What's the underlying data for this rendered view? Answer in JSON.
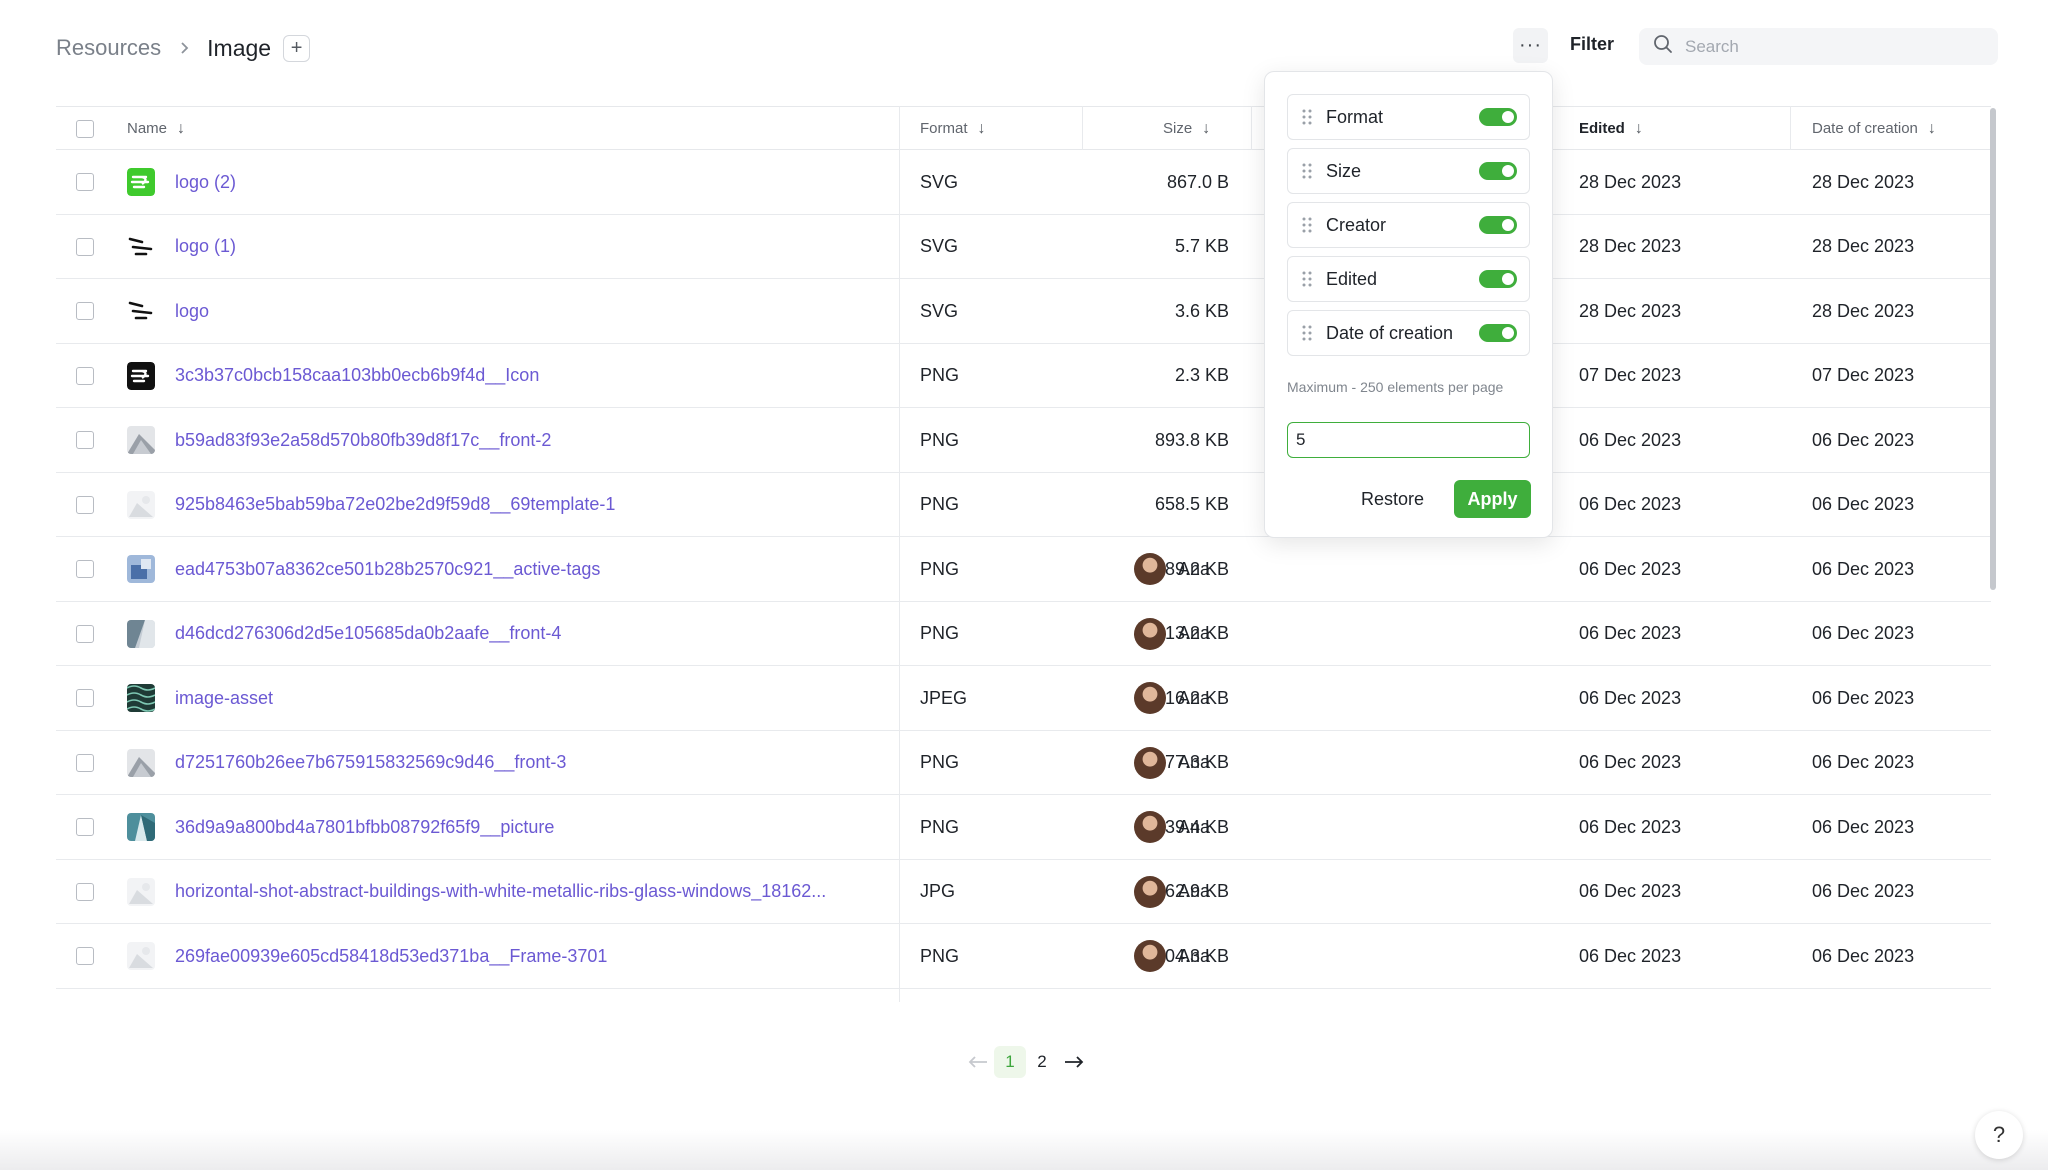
{
  "breadcrumb": {
    "root": "Resources",
    "current": "Image",
    "add_label": "+"
  },
  "toolbar": {
    "more_label": "···",
    "filter_label": "Filter",
    "search_placeholder": "Search"
  },
  "table": {
    "columns": {
      "name": "Name",
      "format": "Format",
      "size": "Size",
      "edited": "Edited",
      "created": "Date of creation"
    },
    "sort_arrow": "↓",
    "rows": [
      {
        "name": "logo (2)",
        "format": "SVG",
        "size": "867.0 B",
        "creator": "",
        "edited": "28 Dec 2023",
        "created": "28 Dec 2023",
        "thumb": "green-logo-icon"
      },
      {
        "name": "logo (1)",
        "format": "SVG",
        "size": "5.7 KB",
        "creator": "",
        "edited": "28 Dec 2023",
        "created": "28 Dec 2023",
        "thumb": "stripes-logo-icon"
      },
      {
        "name": "logo",
        "format": "SVG",
        "size": "3.6 KB",
        "creator": "",
        "edited": "28 Dec 2023",
        "created": "28 Dec 2023",
        "thumb": "stripes-logo-icon"
      },
      {
        "name": "3c3b37c0bcb158caa103bb0ecb6b9f4d__Icon",
        "format": "PNG",
        "size": "2.3 KB",
        "creator": "",
        "edited": "07 Dec 2023",
        "created": "07 Dec 2023",
        "thumb": "black-logo-icon"
      },
      {
        "name": "b59ad83f93e2a58d570b80fb39d8f17c__front-2",
        "format": "PNG",
        "size": "893.8 KB",
        "creator": "",
        "edited": "06 Dec 2023",
        "created": "06 Dec 2023",
        "thumb": "gray-photo"
      },
      {
        "name": "925b8463e5bab59ba72e02be2d9f59d8__69template-1",
        "format": "PNG",
        "size": "658.5 KB",
        "creator": "",
        "edited": "06 Dec 2023",
        "created": "06 Dec 2023",
        "thumb": "light-photo"
      },
      {
        "name": "ead4753b07a8362ce501b28b2570c921__active-tags",
        "format": "PNG",
        "size": "489.2 KB",
        "creator": "Ana",
        "edited": "06 Dec 2023",
        "created": "06 Dec 2023",
        "thumb": "blue-photo"
      },
      {
        "name": "d46dcd276306d2d5e105685da0b2aafe__front-4",
        "format": "PNG",
        "size": "613.2 KB",
        "creator": "Ana",
        "edited": "06 Dec 2023",
        "created": "06 Dec 2023",
        "thumb": "slate-photo"
      },
      {
        "name": "image-asset",
        "format": "JPEG",
        "size": "716.2 KB",
        "creator": "Ana",
        "edited": "06 Dec 2023",
        "created": "06 Dec 2023",
        "thumb": "teal-pattern"
      },
      {
        "name": "d7251760b26ee7b675915832569c9d46__front-3",
        "format": "PNG",
        "size": "977.3 KB",
        "creator": "Ana",
        "edited": "06 Dec 2023",
        "created": "06 Dec 2023",
        "thumb": "gray-photo"
      },
      {
        "name": "36d9a9a800bd4a7801bfbb08792f65f9__picture",
        "format": "PNG",
        "size": "739.4 KB",
        "creator": "Ana",
        "edited": "06 Dec 2023",
        "created": "06 Dec 2023",
        "thumb": "teal-photo"
      },
      {
        "name": "horizontal-shot-abstract-buildings-with-white-metallic-ribs-glass-windows_18162...",
        "format": "JPG",
        "size": "262.9 KB",
        "creator": "Ana",
        "edited": "06 Dec 2023",
        "created": "06 Dec 2023",
        "thumb": "light-photo"
      },
      {
        "name": "269fae00939e605cd58418d53ed371ba__Frame-3701",
        "format": "PNG",
        "size": "604.3 KB",
        "creator": "Ana",
        "edited": "06 Dec 2023",
        "created": "06 Dec 2023",
        "thumb": "light-photo"
      }
    ]
  },
  "popover": {
    "columns": [
      {
        "label": "Format",
        "enabled": true
      },
      {
        "label": "Size",
        "enabled": true
      },
      {
        "label": "Creator",
        "enabled": true
      },
      {
        "label": "Edited",
        "enabled": true
      },
      {
        "label": "Date of creation",
        "enabled": true
      }
    ],
    "note": "Maximum - 250 elements per page",
    "input_value": "5",
    "restore_label": "Restore",
    "apply_label": "Apply"
  },
  "pagination": {
    "pages": [
      "1",
      "2"
    ],
    "current": "1"
  },
  "help_label": "?",
  "colors": {
    "accent": "#3fae3c",
    "link": "#6b59d3"
  }
}
